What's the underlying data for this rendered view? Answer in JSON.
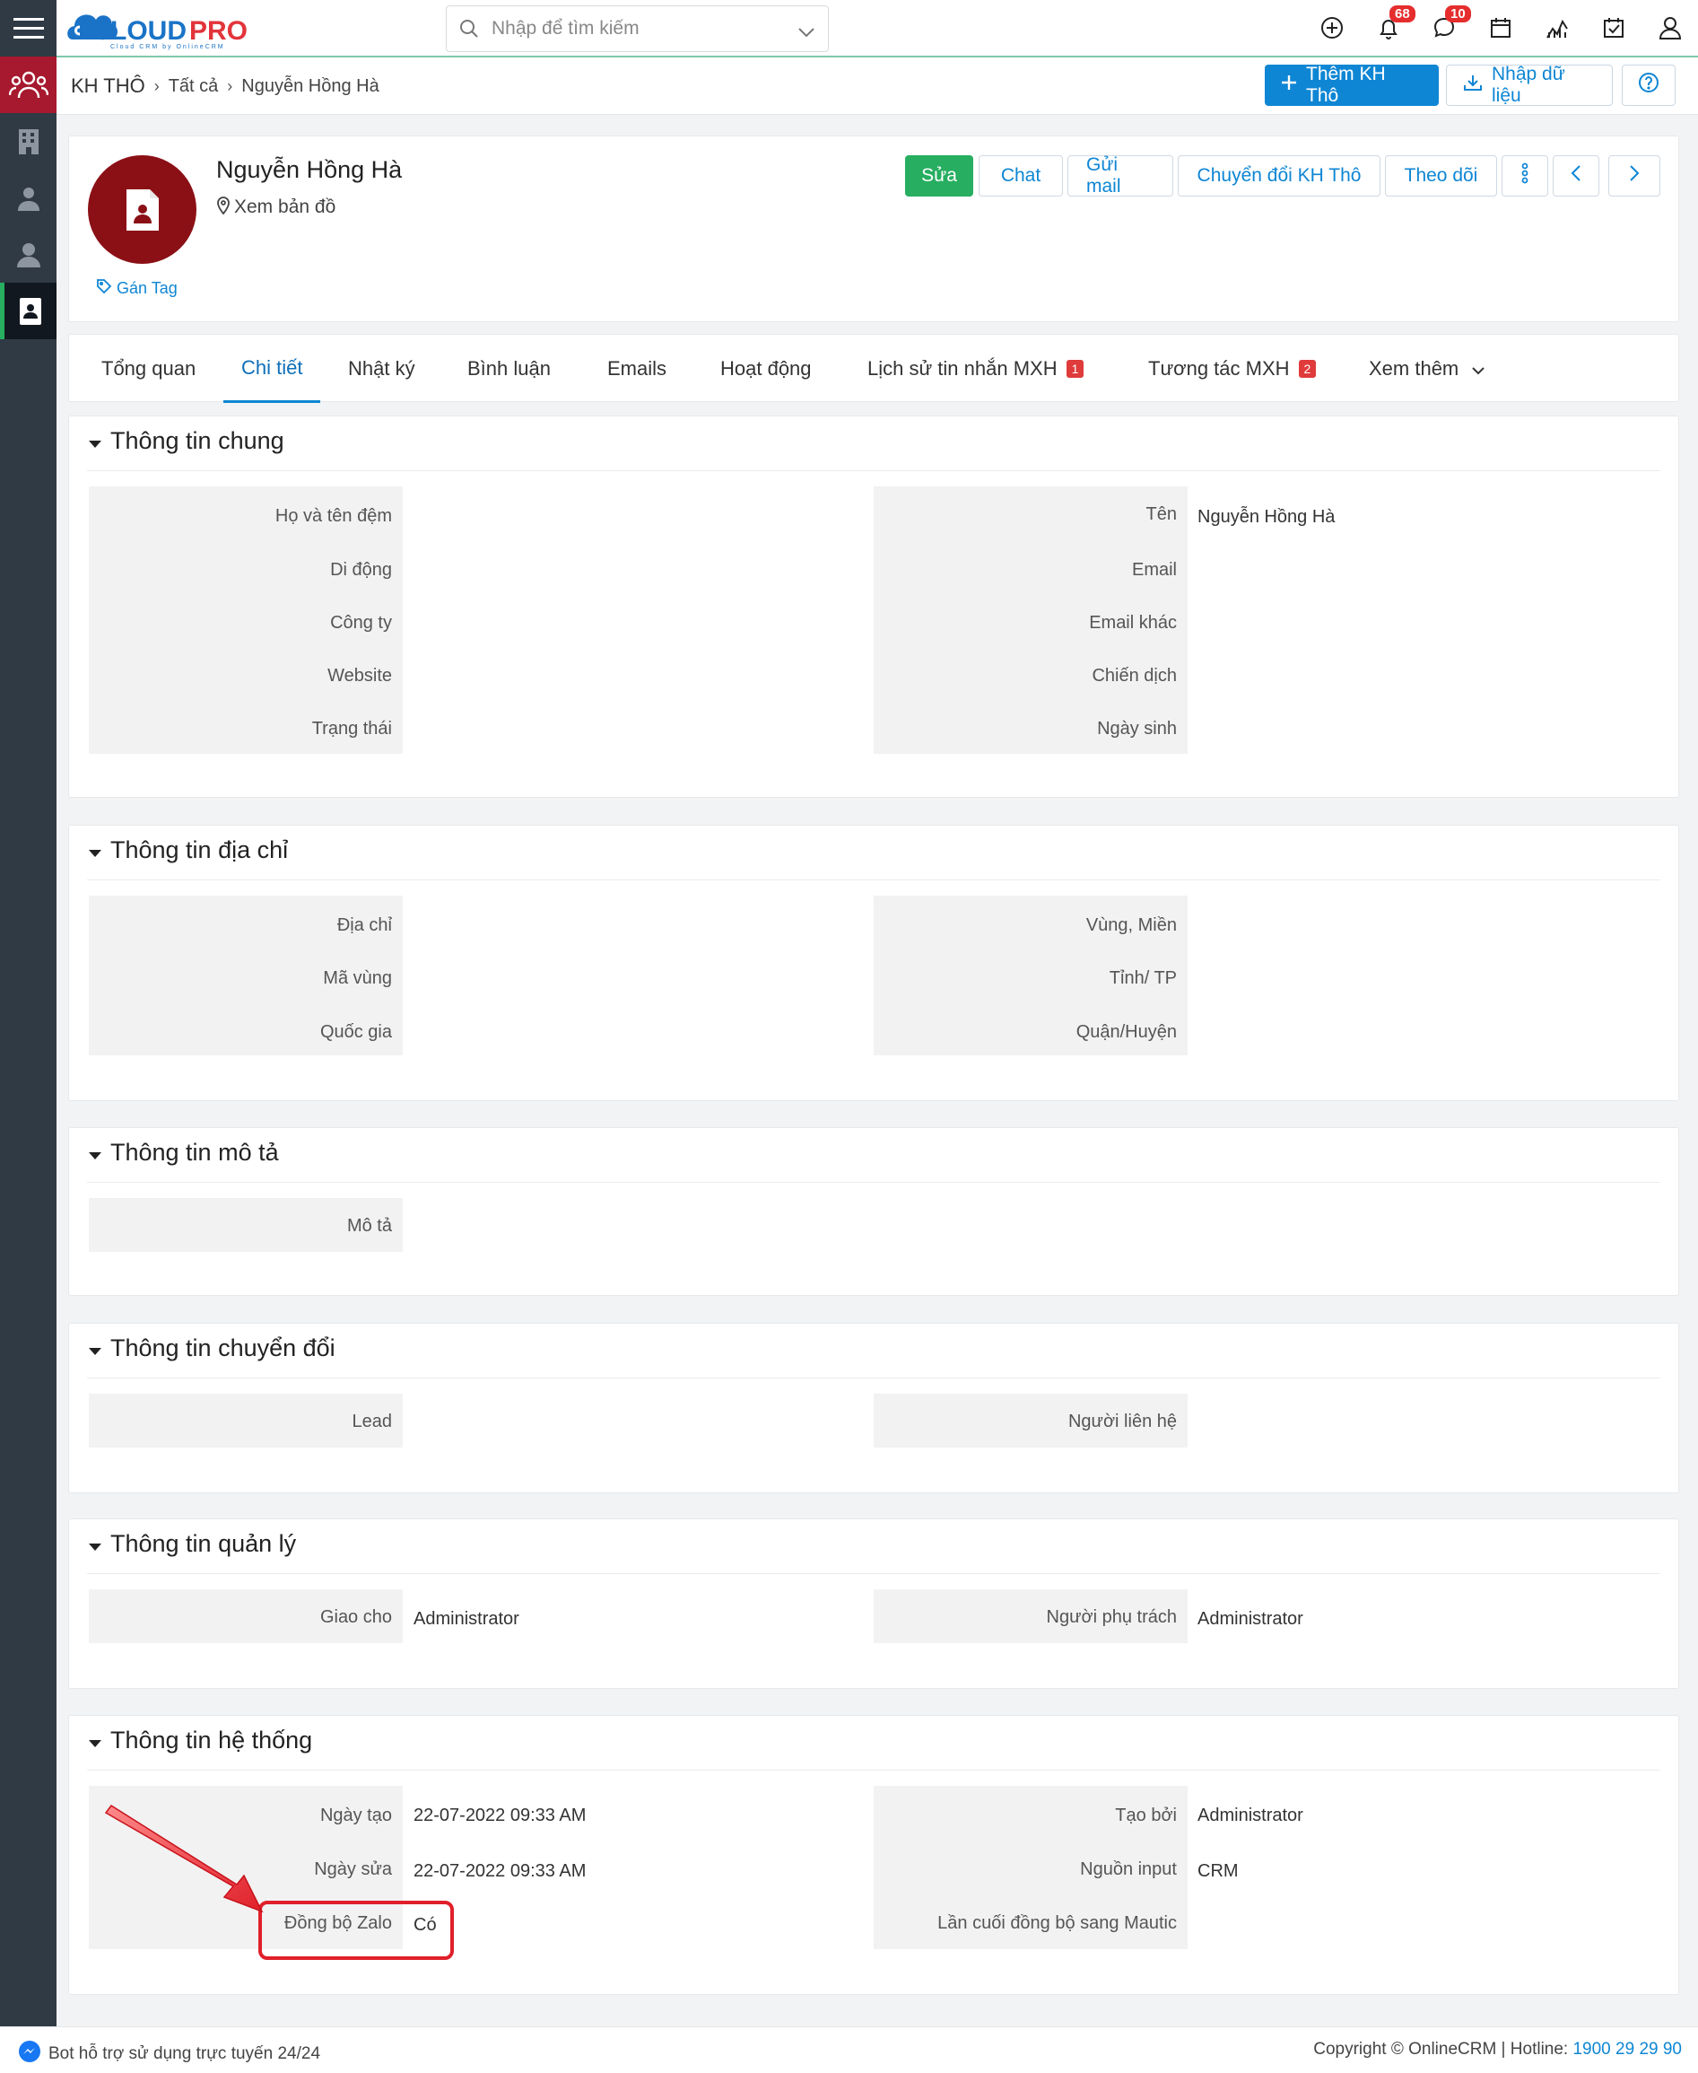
{
  "app": {
    "logo_text": "CLOUDPRO",
    "logo_sub": "Cloud CRM by OnlineCRM"
  },
  "search": {
    "placeholder": "Nhập để tìm kiếm"
  },
  "top_icons": {
    "notifications_count": "68",
    "messages_count": "10"
  },
  "breadcrumb": {
    "root": "KH THÔ",
    "level1": "Tất cả",
    "current": "Nguyễn Hồng Hà"
  },
  "header_actions": {
    "add_label": "Thêm KH Thô",
    "import_label": "Nhập dữ liệu"
  },
  "record": {
    "name": "Nguyễn Hồng Hà",
    "map_link": "Xem bản đồ",
    "tag_link": "Gán Tag"
  },
  "record_actions": {
    "edit": "Sửa",
    "chat": "Chat",
    "send_mail": "Gửi mail",
    "convert": "Chuyển đổi KH Thô",
    "follow": "Theo dõi"
  },
  "tabs": [
    {
      "label": "Tổng quan"
    },
    {
      "label": "Chi tiết"
    },
    {
      "label": "Nhật ký"
    },
    {
      "label": "Bình luận"
    },
    {
      "label": "Emails"
    },
    {
      "label": "Hoạt động"
    },
    {
      "label": "Lịch sử tin nhắn MXH",
      "count": "1"
    },
    {
      "label": "Tương tác MXH",
      "count": "2"
    },
    {
      "label": "Xem thêm"
    }
  ],
  "sections": {
    "general": {
      "title": "Thông tin chung",
      "left": [
        "Họ và tên đệm",
        "Di động",
        "Công ty",
        "Website",
        "Trạng thái"
      ],
      "right": [
        "Tên",
        "Email",
        "Email khác",
        "Chiến dịch",
        "Ngày sinh"
      ],
      "right_values": [
        "Nguyễn Hồng Hà",
        "",
        "",
        "",
        ""
      ]
    },
    "address": {
      "title": "Thông tin địa chỉ",
      "left": [
        "Địa chỉ",
        "Mã vùng",
        "Quốc gia"
      ],
      "right": [
        "Vùng, Miền",
        "Tỉnh/ TP",
        "Quận/Huyện"
      ]
    },
    "description": {
      "title": "Thông tin mô tả",
      "left": [
        "Mô tả"
      ]
    },
    "conversion": {
      "title": "Thông tin chuyển đổi",
      "left": [
        "Lead"
      ],
      "right": [
        "Người liên hệ"
      ]
    },
    "management": {
      "title": "Thông tin quản lý",
      "left": [
        "Giao cho"
      ],
      "left_values": [
        "Administrator"
      ],
      "right": [
        "Người phụ trách"
      ],
      "right_values": [
        "Administrator"
      ]
    },
    "system": {
      "title": "Thông tin hệ thống",
      "left": [
        "Ngày tạo",
        "Ngày sửa",
        "Đồng bộ Zalo"
      ],
      "left_values": [
        "22-07-2022 09:33 AM",
        "22-07-2022 09:33 AM",
        "Có"
      ],
      "right": [
        "Tạo bởi",
        "Nguồn input",
        "Lần cuối đồng bộ sang Mautic"
      ],
      "right_values": [
        "Administrator",
        "CRM",
        ""
      ]
    }
  },
  "footer": {
    "bot_text": "Bot hỗ trợ sử dụng trực tuyến 24/24",
    "copyright": "Copyright © OnlineCRM | Hotline: ",
    "hotline": "1900 29 29 90"
  },
  "colors": {
    "primary": "#0e86d4",
    "success": "#27ae60",
    "sidebar": "#2f3a45",
    "sidebar_active": "#a6192e",
    "avatar": "#8b1016",
    "annotation": "#e0202a"
  }
}
